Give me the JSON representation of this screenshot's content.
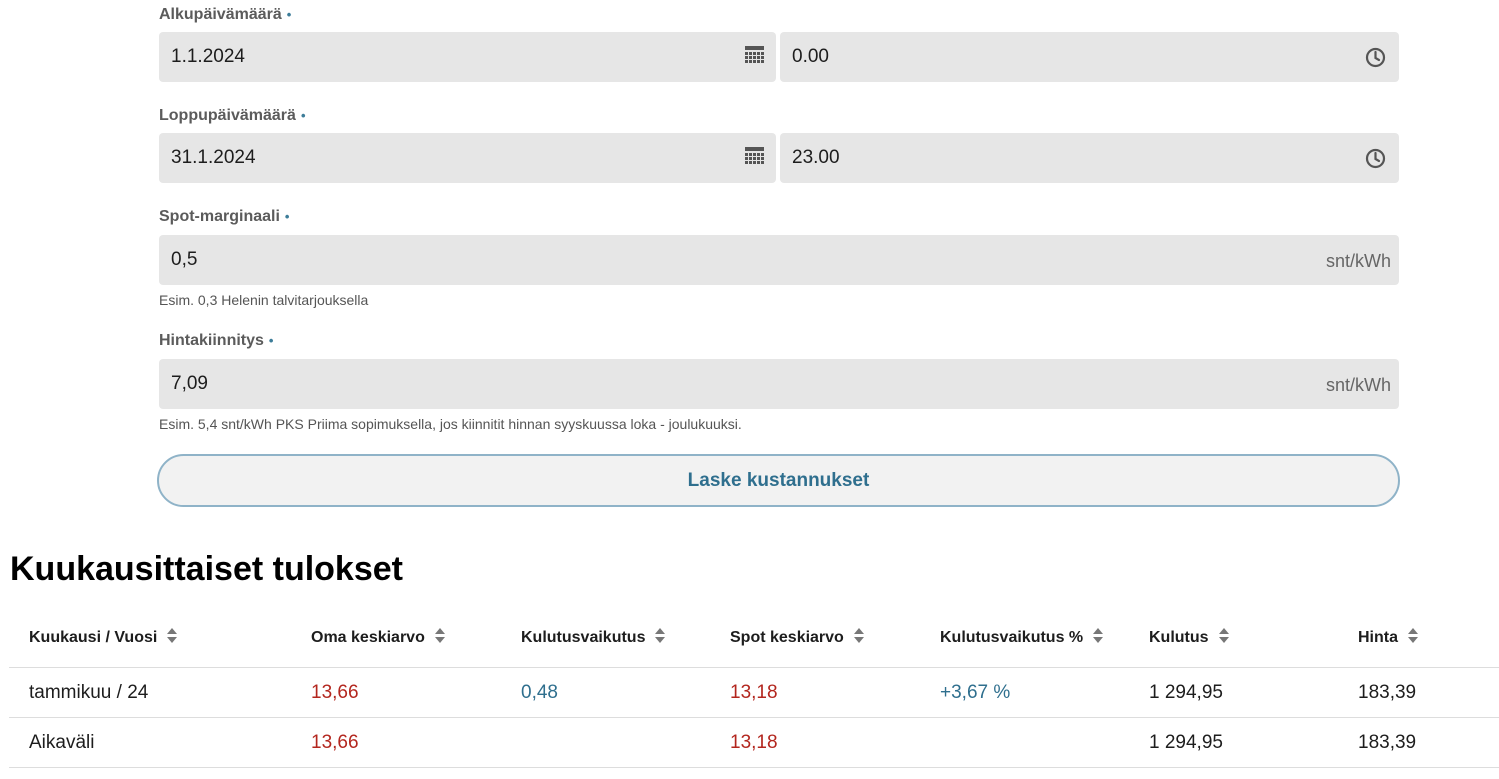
{
  "form": {
    "start": {
      "label": "Alkupäivämäärä",
      "date": "1.1.2024",
      "time": "0.00"
    },
    "end": {
      "label": "Loppupäivämäärä",
      "date": "31.1.2024",
      "time": "23.00"
    },
    "spot_margin": {
      "label": "Spot-marginaali",
      "value": "0,5",
      "unit": "snt/kWh",
      "help": "Esim. 0,3 Helenin talvitarjouksella"
    },
    "price_lock": {
      "label": "Hintakiinnitys",
      "value": "7,09",
      "unit": "snt/kWh",
      "help": "Esim. 5,4 snt/kWh PKS Priima sopimuksella, jos kiinnitit hinnan syyskuussa loka - joulukuuksi."
    },
    "required_marker": "•",
    "calculate_label": "Laske kustannukset"
  },
  "results": {
    "title": "Kuukausittaiset tulokset",
    "columns": [
      "Kuukausi / Vuosi",
      "Oma keskiarvo",
      "Kulutusvaikutus",
      "Spot keskiarvo",
      "Kulutusvaikutus %",
      "Kulutus",
      "Hinta"
    ],
    "rows": [
      [
        "tammikuu / 24",
        "13,66",
        "0,48",
        "13,18",
        "+3,67 %",
        "1 294,95",
        "183,39"
      ],
      [
        "Aikaväli",
        "13,66",
        "",
        "13,18",
        "",
        "1 294,95",
        "183,39"
      ]
    ]
  },
  "icons": {
    "date": "calendar-icon",
    "time": "clock-icon",
    "sort": "sort-icon"
  },
  "colors": {
    "accent": "#2f6f8e",
    "negative": "#b3261e",
    "field_bg": "#e6e6e6",
    "button_border": "#8fb3c8"
  }
}
